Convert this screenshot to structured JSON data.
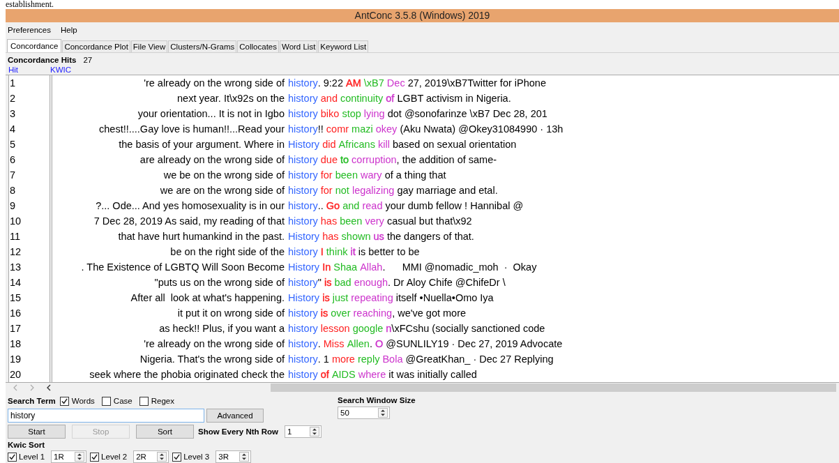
{
  "document_text": "establishment.",
  "window": {
    "title": "AntConc 3.5.8 (Windows) 2019"
  },
  "menu": [
    "Preferences",
    "Help"
  ],
  "tabs": [
    {
      "label": "Concordance",
      "selected": true
    },
    {
      "label": "Concordance Plot",
      "selected": false
    },
    {
      "label": "File View",
      "selected": false
    },
    {
      "label": "Clusters/N-Grams",
      "selected": false
    },
    {
      "label": "Collocates",
      "selected": false
    },
    {
      "label": "Word List",
      "selected": false
    },
    {
      "label": "Keyword List",
      "selected": false
    }
  ],
  "hits": {
    "label": "Concordance Hits",
    "count": "27"
  },
  "table": {
    "columns": [
      "Hit",
      "KWIC"
    ],
    "rows": [
      {
        "hit": "1",
        "left": "'re already on the wrong side of",
        "right": [
          {
            "text": "history",
            "color": "#3366ff"
          },
          {
            "text": ". 9:22 ",
            "color": "#000000"
          },
          {
            "text": "AM",
            "color": "#ff2020"
          },
          {
            "text": " \\xB7",
            "color": "#22bb22"
          },
          {
            "text": " Dec",
            "color": "#cc33cc"
          },
          {
            "text": " 27, 2019\\xB7Twitter for iPhone",
            "color": "#000000"
          }
        ]
      },
      {
        "hit": "2",
        "left": "next year. It\\x92s on the",
        "right": [
          {
            "text": "history",
            "color": "#3366ff"
          },
          {
            "text": " and",
            "color": "#ff2020"
          },
          {
            "text": " continuity",
            "color": "#22bb22"
          },
          {
            "text": " of",
            "color": "#cc33cc"
          },
          {
            "text": " LGBT activism in Nigeria.",
            "color": "#000000"
          }
        ]
      },
      {
        "hit": "3",
        "left": "your orientation... It is not in Igbo",
        "right": [
          {
            "text": "history",
            "color": "#3366ff"
          },
          {
            "text": " biko",
            "color": "#ff2020"
          },
          {
            "text": " stop",
            "color": "#22bb22"
          },
          {
            "text": " lying",
            "color": "#cc33cc"
          },
          {
            "text": " dot @sonofarinze \\xB7 Dec 28, 201",
            "color": "#000000"
          }
        ]
      },
      {
        "hit": "4",
        "left": "chest!!....Gay love is human!!...Read your",
        "right": [
          {
            "text": "history",
            "color": "#3366ff"
          },
          {
            "text": "!!"
          },
          {
            "text": " comr",
            "color": "#ff2020"
          },
          {
            "text": " mazi",
            "color": "#22bb22"
          },
          {
            "text": " okey",
            "color": "#cc33cc"
          },
          {
            "text": " (Aku Nwata) @Okey31084990 · 13h",
            "color": "#000000"
          }
        ]
      },
      {
        "hit": "5",
        "left": "the basis of your argument. Where in",
        "right": [
          {
            "text": "History",
            "color": "#3366ff"
          },
          {
            "text": " did",
            "color": "#ff2020"
          },
          {
            "text": " Africans",
            "color": "#22bb22"
          },
          {
            "text": " kill",
            "color": "#cc33cc"
          },
          {
            "text": " based on sexual orientation",
            "color": "#000000"
          }
        ]
      },
      {
        "hit": "6",
        "left": "are already on the wrong side of",
        "right": [
          {
            "text": "history",
            "color": "#3366ff"
          },
          {
            "text": " due",
            "color": "#ff2020"
          },
          {
            "text": " to",
            "color": "#22bb22"
          },
          {
            "text": " corruption",
            "color": "#cc33cc"
          },
          {
            "text": ", the addition of same-",
            "color": "#000000"
          }
        ]
      },
      {
        "hit": "7",
        "left": "we be on the wrong side of",
        "right": [
          {
            "text": "history",
            "color": "#3366ff"
          },
          {
            "text": " for",
            "color": "#ff2020"
          },
          {
            "text": " been",
            "color": "#22bb22"
          },
          {
            "text": " wary",
            "color": "#cc33cc"
          },
          {
            "text": " of a thing that",
            "color": "#000000"
          }
        ]
      },
      {
        "hit": "8",
        "left": "we are on the wrong side of",
        "right": [
          {
            "text": "history",
            "color": "#3366ff"
          },
          {
            "text": " for",
            "color": "#ff2020"
          },
          {
            "text": " not",
            "color": "#22bb22"
          },
          {
            "text": " legalizing",
            "color": "#cc33cc"
          },
          {
            "text": " gay marriage and etal.",
            "color": "#000000"
          }
        ]
      },
      {
        "hit": "9",
        "left": "?... Ode... And yes homosexuality is in our",
        "right": [
          {
            "text": "history",
            "color": "#3366ff"
          },
          {
            "text": ".."
          },
          {
            "text": " Go",
            "color": "#ff2020"
          },
          {
            "text": " and",
            "color": "#22bb22"
          },
          {
            "text": " read",
            "color": "#cc33cc"
          },
          {
            "text": " your dumb fellow ! Hannibal @",
            "color": "#000000"
          }
        ]
      },
      {
        "hit": "10",
        "left": "7 Dec 28, 2019 As said, my reading of that",
        "right": [
          {
            "text": "history",
            "color": "#3366ff"
          },
          {
            "text": " has",
            "color": "#ff2020"
          },
          {
            "text": " been",
            "color": "#22bb22"
          },
          {
            "text": " very",
            "color": "#cc33cc"
          },
          {
            "text": " casual but that\\x92",
            "color": "#000000"
          }
        ]
      },
      {
        "hit": "11",
        "left": "that have hurt humankind in the past.",
        "right": [
          {
            "text": "History",
            "color": "#3366ff"
          },
          {
            "text": " has",
            "color": "#ff2020"
          },
          {
            "text": " shown",
            "color": "#22bb22"
          },
          {
            "text": " us",
            "color": "#cc33cc"
          },
          {
            "text": " the dangers of that.",
            "color": "#000000"
          }
        ]
      },
      {
        "hit": "12",
        "left": "be on the right side of the",
        "right": [
          {
            "text": "history",
            "color": "#3366ff"
          },
          {
            "text": " I",
            "color": "#ff2020"
          },
          {
            "text": " think",
            "color": "#22bb22"
          },
          {
            "text": " it",
            "color": "#cc33cc"
          },
          {
            "text": " is better to be",
            "color": "#000000"
          }
        ]
      },
      {
        "hit": "13",
        "left": ". The Existence of LGBTQ Will Soon Become",
        "right": [
          {
            "text": "History",
            "color": "#3366ff"
          },
          {
            "text": " In",
            "color": "#ff2020"
          },
          {
            "text": " Shaa",
            "color": "#22bb22"
          },
          {
            "text": " Allah",
            "color": "#cc33cc"
          },
          {
            "text": ".      MMI @nomadic_moh  ·  Okay",
            "color": "#000000"
          }
        ]
      },
      {
        "hit": "14",
        "left": "\"puts us on the wrong side of",
        "right": [
          {
            "text": "history",
            "color": "#3366ff"
          },
          {
            "text": "\""
          },
          {
            "text": " is",
            "color": "#ff2020"
          },
          {
            "text": " bad",
            "color": "#22bb22"
          },
          {
            "text": " enough",
            "color": "#cc33cc"
          },
          {
            "text": ". Dr Aloy Chife @ChifeDr \\",
            "color": "#000000"
          }
        ]
      },
      {
        "hit": "15",
        "left": "After all  look at what's happening.",
        "right": [
          {
            "text": "History",
            "color": "#3366ff"
          },
          {
            "text": " is",
            "color": "#ff2020"
          },
          {
            "text": " just",
            "color": "#22bb22"
          },
          {
            "text": " repeating",
            "color": "#cc33cc"
          },
          {
            "text": " itself •Nuella•Omo Iya",
            "color": "#000000"
          }
        ]
      },
      {
        "hit": "16",
        "left": "it put it on wrong side of",
        "right": [
          {
            "text": "history",
            "color": "#3366ff"
          },
          {
            "text": " is",
            "color": "#ff2020"
          },
          {
            "text": " over",
            "color": "#22bb22"
          },
          {
            "text": " reaching",
            "color": "#cc33cc"
          },
          {
            "text": ", we've got more",
            "color": "#000000"
          }
        ]
      },
      {
        "hit": "17",
        "left": "as heck!! Plus, if you want a",
        "right": [
          {
            "text": "history",
            "color": "#3366ff"
          },
          {
            "text": " lesson",
            "color": "#ff2020"
          },
          {
            "text": " google",
            "color": "#22bb22"
          },
          {
            "text": " n",
            "color": "#cc33cc"
          },
          {
            "text": "\\xFCshu (socially sanctioned code",
            "color": "#000000"
          }
        ]
      },
      {
        "hit": "18",
        "left": "'re already on the wrong side of",
        "right": [
          {
            "text": "history",
            "color": "#3366ff"
          },
          {
            "text": "."
          },
          {
            "text": " Miss",
            "color": "#ff2020"
          },
          {
            "text": " Allen",
            "color": "#22bb22"
          },
          {
            "text": "."
          },
          {
            "text": " O",
            "color": "#cc33cc"
          },
          {
            "text": " @SUNLILY19 · Dec 27, 2019 Advocate",
            "color": "#000000"
          }
        ]
      },
      {
        "hit": "19",
        "left": "Nigeria. That's the wrong side of",
        "right": [
          {
            "text": "history",
            "color": "#3366ff"
          },
          {
            "text": ". 1",
            "color": "#000000"
          },
          {
            "text": " more",
            "color": "#ff2020"
          },
          {
            "text": " reply",
            "color": "#22bb22"
          },
          {
            "text": " Bola",
            "color": "#cc33cc"
          },
          {
            "text": " @GreatKhan_ · Dec 27 Replying",
            "color": "#000000"
          }
        ]
      },
      {
        "hit": "20",
        "left": "seek where the phobia originated check the",
        "right": [
          {
            "text": "history",
            "color": "#3366ff"
          },
          {
            "text": " of",
            "color": "#ff2020"
          },
          {
            "text": " AIDS",
            "color": "#22bb22"
          },
          {
            "text": " where",
            "color": "#cc33cc"
          },
          {
            "text": " it was initially called",
            "color": "#000000"
          }
        ]
      }
    ]
  },
  "search": {
    "label": "Search Term",
    "options": [
      {
        "label": "Words",
        "checked": true
      },
      {
        "label": "Case",
        "checked": false
      },
      {
        "label": "Regex",
        "checked": false
      }
    ],
    "value": "history",
    "advanced": "Advanced"
  },
  "buttons": [
    {
      "label": "Start",
      "disabled": false
    },
    {
      "label": "Stop",
      "disabled": true
    },
    {
      "label": "Sort",
      "disabled": false
    }
  ],
  "nth_row": {
    "label": "Show Every Nth Row",
    "value": "1"
  },
  "window_size": {
    "label": "Search Window Size",
    "value": "50"
  },
  "kwic_sort": {
    "label": "Kwic Sort",
    "levels": [
      {
        "label": "Level 1",
        "checked": true,
        "value": "1R"
      },
      {
        "label": "Level 2",
        "checked": true,
        "value": "2R"
      },
      {
        "label": "Level 3",
        "checked": true,
        "value": "3R"
      }
    ]
  }
}
